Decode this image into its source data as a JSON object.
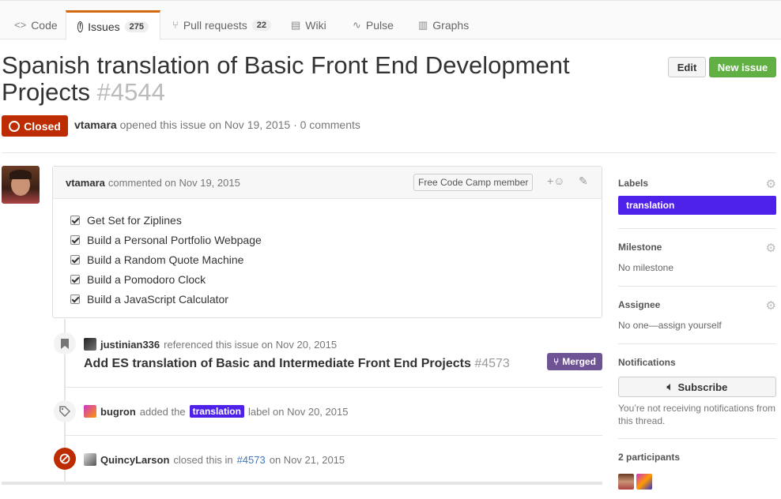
{
  "tabs": [
    {
      "label": "Code",
      "icon": "code-icon",
      "glyph": "<>"
    },
    {
      "label": "Issues",
      "icon": "issue-icon",
      "glyph": "!",
      "count": "275"
    },
    {
      "label": "Pull requests",
      "icon": "pull-request-icon",
      "glyph": "⑂",
      "count": "22"
    },
    {
      "label": "Wiki",
      "icon": "book-icon",
      "glyph": "▤"
    },
    {
      "label": "Pulse",
      "icon": "pulse-icon",
      "glyph": "∿"
    },
    {
      "label": "Graphs",
      "icon": "graph-icon",
      "glyph": "▥"
    }
  ],
  "issue": {
    "title": "Spanish translation of Basic Front End Development Projects",
    "number": "#4544",
    "state": "Closed",
    "author": "vtamara",
    "opened_text": "opened this issue on Nov 19, 2015 · 0 comments"
  },
  "buttons": {
    "edit": "Edit",
    "new_issue": "New issue"
  },
  "comment": {
    "author": "vtamara",
    "date_text": "commented on Nov 19, 2015",
    "badge": "Free Code Camp member",
    "tasks": [
      "Get Set for Ziplines",
      "Build a Personal Portfolio Webpage",
      "Build a Random Quote Machine",
      "Build a Pomodoro Clock",
      "Build a JavaScript Calculator"
    ]
  },
  "events": {
    "reference": {
      "user": "justinian336",
      "text": "referenced this issue on Nov 20, 2015",
      "pr_title": "Add ES translation of Basic and Intermediate Front End Projects",
      "pr_number": "#4573",
      "pr_state": "Merged"
    },
    "label": {
      "user": "bugron",
      "before": "added the",
      "label": "translation",
      "after": "label on Nov 20, 2015"
    },
    "closed": {
      "user": "QuincyLarson",
      "before": "closed this in",
      "ref": "#4573",
      "after": "on Nov 21, 2015"
    }
  },
  "sidebar": {
    "labels": {
      "heading": "Labels",
      "value": "translation",
      "color": "#4d21e8"
    },
    "milestone": {
      "heading": "Milestone",
      "value": "No milestone"
    },
    "assignee": {
      "heading": "Assignee",
      "value": "No one—assign yourself"
    },
    "notifications": {
      "heading": "Notifications",
      "button": "Subscribe",
      "note": "You’re not receiving notifications from this thread."
    },
    "participants": {
      "heading": "2 participants"
    }
  },
  "colors": {
    "closed": "#bd2c00",
    "merged": "#6e5494",
    "new_issue": "#60b044",
    "label": "#4d21e8"
  }
}
